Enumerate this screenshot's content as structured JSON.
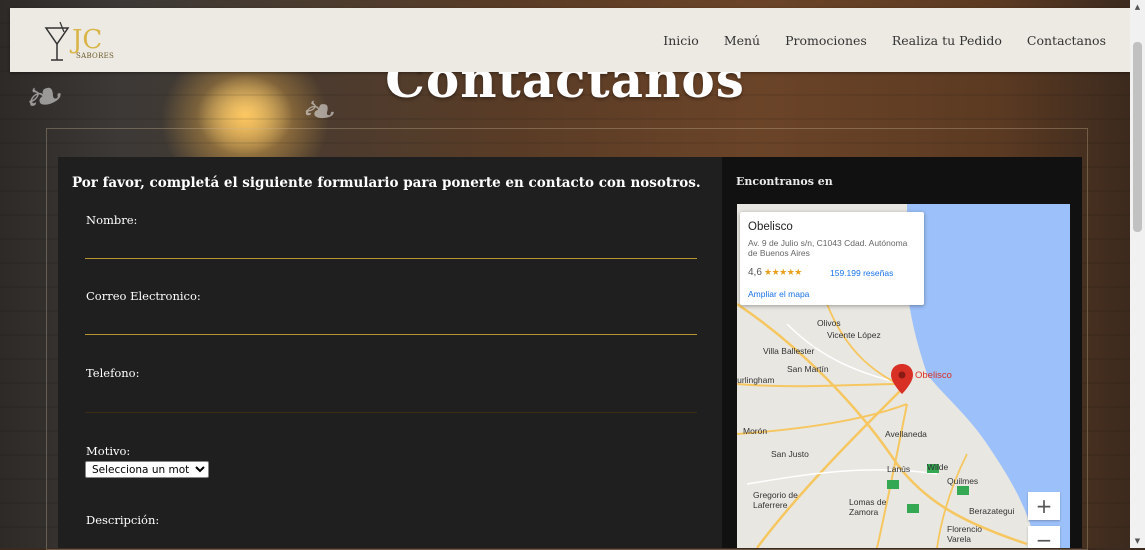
{
  "header": {
    "logo_text": "SABORES",
    "nav": [
      "Inicio",
      "Menú",
      "Promociones",
      "Realiza tu Pedido",
      "Contactanos"
    ]
  },
  "page": {
    "title": "Contactanos"
  },
  "form": {
    "heading": "Por favor, completá el siguiente formulario para ponerte en contacto con nosotros.",
    "nombre_label": "Nombre:",
    "correo_label": "Correo Electronico:",
    "telefono_label": "Telefono:",
    "motivo_label": "Motivo:",
    "motivo_selected": "Selecciona un motivo",
    "descripcion_label": "Descripción:"
  },
  "map": {
    "heading": "Encontranos en",
    "place_name": "Obelisco",
    "place_address": "Av. 9 de Julio s/n, C1043 Cdad. Autónoma de Buenos Aires",
    "rating": "4,6",
    "stars": "★★★★★",
    "reviews": "159.199 reseñas",
    "enlarge_link": "Ampliar el mapa",
    "pin_label": "Obelisco",
    "labels": [
      "Olivos",
      "Vicente López",
      "Villa Ballester",
      "San Martín",
      "Hurlingham",
      "Morón",
      "Avellaneda",
      "San Justo",
      "Lanús",
      "Wilde",
      "Quilmes",
      "Gregorio de Laferrere",
      "Lomas de Zamora",
      "Berazategui",
      "Florencio Varela"
    ],
    "zoom_in": "+",
    "zoom_out": "−"
  },
  "colors": {
    "header_bg": "#eceae2",
    "panel_bg": "#1f1f1f",
    "input_underline": "#b8952f",
    "pin": "#d93025"
  }
}
